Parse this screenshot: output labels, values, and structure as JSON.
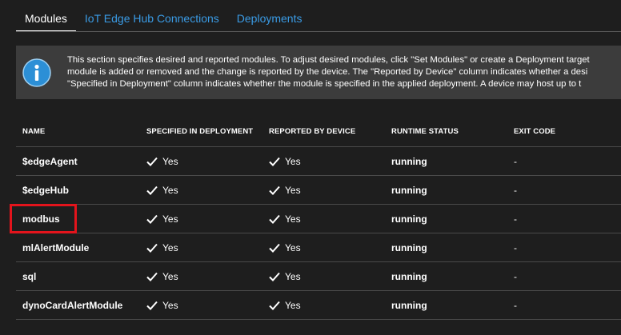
{
  "tabs": [
    {
      "label": "Modules",
      "active": true
    },
    {
      "label": "IoT Edge Hub Connections",
      "active": false
    },
    {
      "label": "Deployments",
      "active": false
    }
  ],
  "info": {
    "icon": "info-icon",
    "lines": [
      "This section specifies desired and reported modules.  To adjust desired modules, click \"Set Modules\" or create a Deployment target",
      "module is added or removed and the change is reported by the device.  The \"Reported by Device\" column indicates whether a desi",
      "\"Specified in Deployment\" column indicates whether the module is specified in the applied deployment.  A device may host up to t"
    ]
  },
  "table": {
    "headers": [
      "NAME",
      "SPECIFIED IN DEPLOYMENT",
      "REPORTED BY DEVICE",
      "RUNTIME STATUS",
      "EXIT CODE"
    ],
    "rows": [
      {
        "name": "$edgeAgent",
        "specified": "Yes",
        "reported": "Yes",
        "status": "running",
        "exit": "-"
      },
      {
        "name": "$edgeHub",
        "specified": "Yes",
        "reported": "Yes",
        "status": "running",
        "exit": "-"
      },
      {
        "name": "modbus",
        "specified": "Yes",
        "reported": "Yes",
        "status": "running",
        "exit": "-"
      },
      {
        "name": "mlAlertModule",
        "specified": "Yes",
        "reported": "Yes",
        "status": "running",
        "exit": "-"
      },
      {
        "name": "sql",
        "specified": "Yes",
        "reported": "Yes",
        "status": "running",
        "exit": "-"
      },
      {
        "name": "dynoCardAlertModule",
        "specified": "Yes",
        "reported": "Yes",
        "status": "running",
        "exit": "-"
      }
    ]
  },
  "colors": {
    "background": "#1e1e1e",
    "accent": "#3a9be5",
    "info_panel": "#3c3c3c",
    "highlight": "#e3141c"
  }
}
